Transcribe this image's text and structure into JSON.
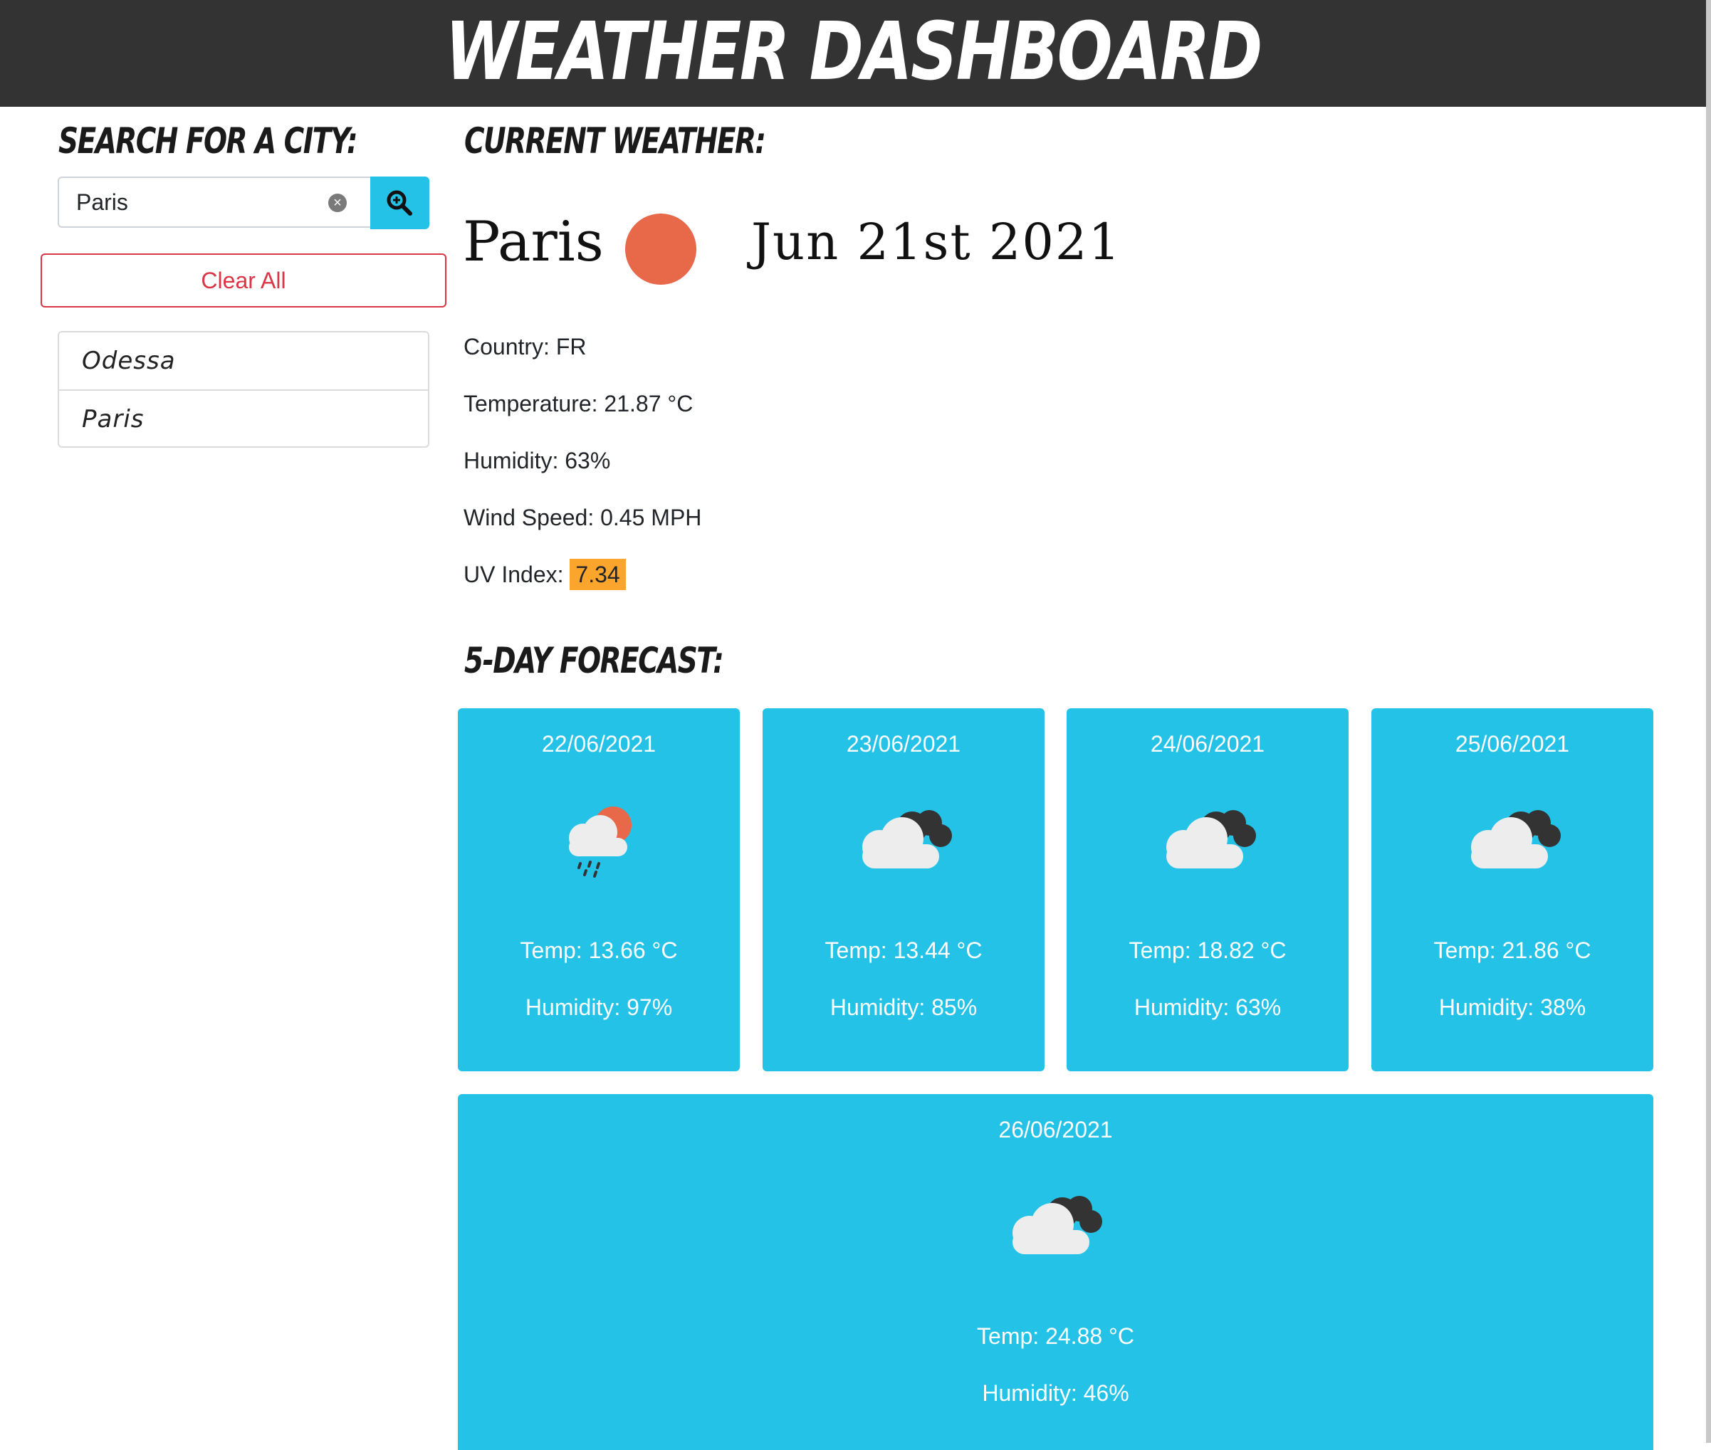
{
  "app": {
    "title": "Weather Dashboard"
  },
  "sidebar": {
    "heading": "Search for a city:",
    "search": {
      "value": "Paris",
      "placeholder": ""
    },
    "clear_all_label": "Clear All",
    "history": [
      "Odessa",
      "Paris"
    ]
  },
  "current": {
    "heading": "Current Weather:",
    "city": "Paris",
    "date": "Jun 21st 2021",
    "icon": "sun-icon",
    "country": "Country: FR",
    "temperature": "Temperature: 21.87 °C",
    "humidity": "Humidity: 63%",
    "wind": "Wind Speed: 0.45 MPH",
    "uv_label": "UV Index:",
    "uv_value": "7.34"
  },
  "forecast": {
    "heading": "5-Day Forecast:",
    "days": [
      {
        "date": "22/06/2021",
        "icon": "rain-sun-icon",
        "temp": "Temp: 13.66 °C",
        "humidity": "Humidity: 97%"
      },
      {
        "date": "23/06/2021",
        "icon": "cloudy-icon",
        "temp": "Temp: 13.44 °C",
        "humidity": "Humidity: 85%"
      },
      {
        "date": "24/06/2021",
        "icon": "cloudy-icon",
        "temp": "Temp: 18.82 °C",
        "humidity": "Humidity: 63%"
      },
      {
        "date": "25/06/2021",
        "icon": "cloudy-icon",
        "temp": "Temp: 21.86 °C",
        "humidity": "Humidity: 38%"
      },
      {
        "date": "26/06/2021",
        "icon": "cloudy-icon",
        "temp": "Temp: 24.88 °C",
        "humidity": "Humidity: 46%"
      }
    ]
  },
  "colors": {
    "header": "#333333",
    "accent": "#25c2e8",
    "danger": "#dc3545",
    "uv": "#fca52d",
    "sun": "#e8684a"
  }
}
